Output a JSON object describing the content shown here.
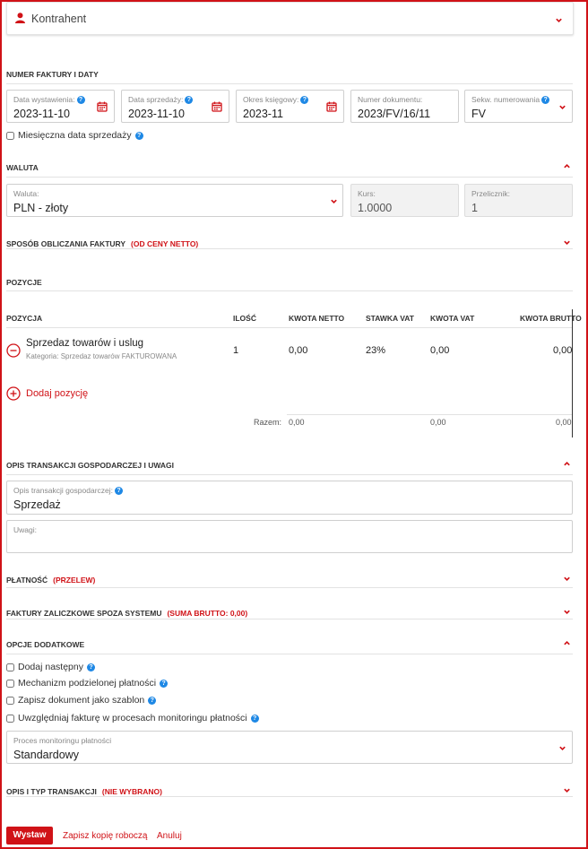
{
  "contractor": {
    "label": "Kontrahent"
  },
  "invoice_numbers": {
    "title": "NUMER FAKTURY I DATY",
    "issue_date": {
      "label": "Data wystawienia:",
      "value": "2023-11-10"
    },
    "sale_date": {
      "label": "Data sprzedaży:",
      "value": "2023-11-10"
    },
    "period": {
      "label": "Okres księgowy:",
      "value": "2023-11"
    },
    "doc_number": {
      "label": "Numer dokumentu:",
      "value": "2023/FV/16/11"
    },
    "numbering": {
      "label": "Sekw. numerowania",
      "value": "FV"
    },
    "monthly_checkbox": "Miesięczna data sprzedaży"
  },
  "currency": {
    "title": "WALUTA",
    "currency": {
      "label": "Waluta:",
      "value": "PLN - złoty"
    },
    "rate": {
      "label": "Kurs:",
      "value": "1.0000"
    },
    "converter": {
      "label": "Przelicznik:",
      "value": "1"
    }
  },
  "calc": {
    "title": "SPOSÓB OBLICZANIA FAKTURY",
    "tag": "(OD CENY NETTO)"
  },
  "positions": {
    "title": "POZYCJE",
    "headers": {
      "pos": "POZYCJA",
      "qty": "ILOŚĆ",
      "net": "KWOTA NETTO",
      "vat_rate": "STAWKA VAT",
      "vat": "KWOTA VAT",
      "gross": "KWOTA BRUTTO"
    },
    "item": {
      "name": "Sprzedaz towarów i uslug",
      "category": "Kategoria: Sprzedaz towarów FAKTUROWANA",
      "qty": "1",
      "net": "0,00",
      "vat_rate": "23%",
      "vat": "0,00",
      "gross": "0,00"
    },
    "add_label": "Dodaj pozycję",
    "total": {
      "label": "Razem:",
      "net": "0,00",
      "vat": "0,00",
      "gross": "0,00"
    }
  },
  "description": {
    "title": "OPIS TRANSAKCJI GOSPODARCZEJ I UWAGI",
    "desc": {
      "label": "Opis transakcji gospodarczej:",
      "value": "Sprzedaż"
    },
    "notes": {
      "label": "Uwagi:",
      "value": ""
    }
  },
  "payment": {
    "title": "PŁATNOŚĆ",
    "tag": "(PRZELEW)"
  },
  "advance": {
    "title": "FAKTURY ZALICZKOWE SPOZA SYSTEMU",
    "tag": "(SUMA BRUTTO: 0,00)"
  },
  "options": {
    "title": "OPCJE DODATKOWE",
    "items": [
      "Dodaj następny",
      "Mechanizm podzielonej płatności",
      "Zapisz dokument jako szablon",
      "Uwzględniaj fakturę w procesach monitoringu płatności"
    ],
    "monitoring": {
      "label": "Proces monitoringu płatności",
      "value": "Standardowy"
    }
  },
  "transaction_type": {
    "title": "OPIS I TYP TRANSAKCJI",
    "tag": "(NIE WYBRANO)"
  },
  "footer": {
    "submit": "Wystaw",
    "save_draft": "Zapisz kopię roboczą",
    "cancel": "Anuluj"
  },
  "colors": {
    "accent": "#d01217",
    "help": "#1e88e5"
  }
}
